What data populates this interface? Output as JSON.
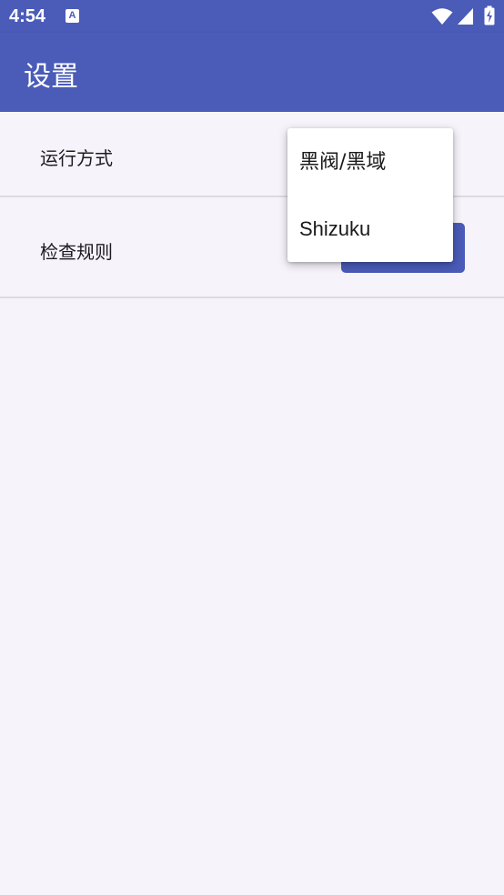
{
  "status_bar": {
    "time": "4:54",
    "notification_glyph": "A",
    "icons": [
      "wifi-icon",
      "cellular-signal-icon",
      "battery-charging-icon"
    ]
  },
  "app_bar": {
    "title": "设置",
    "color": "#4a5bb8"
  },
  "settings": [
    {
      "label": "运行方式"
    },
    {
      "label": "检查规则"
    }
  ],
  "dropdown": {
    "options": [
      "黑阀/黑域",
      "Shizuku"
    ]
  },
  "colors": {
    "accent": "#4a5bb8",
    "background": "#f6f4fa",
    "divider": "#dcdbe1"
  }
}
